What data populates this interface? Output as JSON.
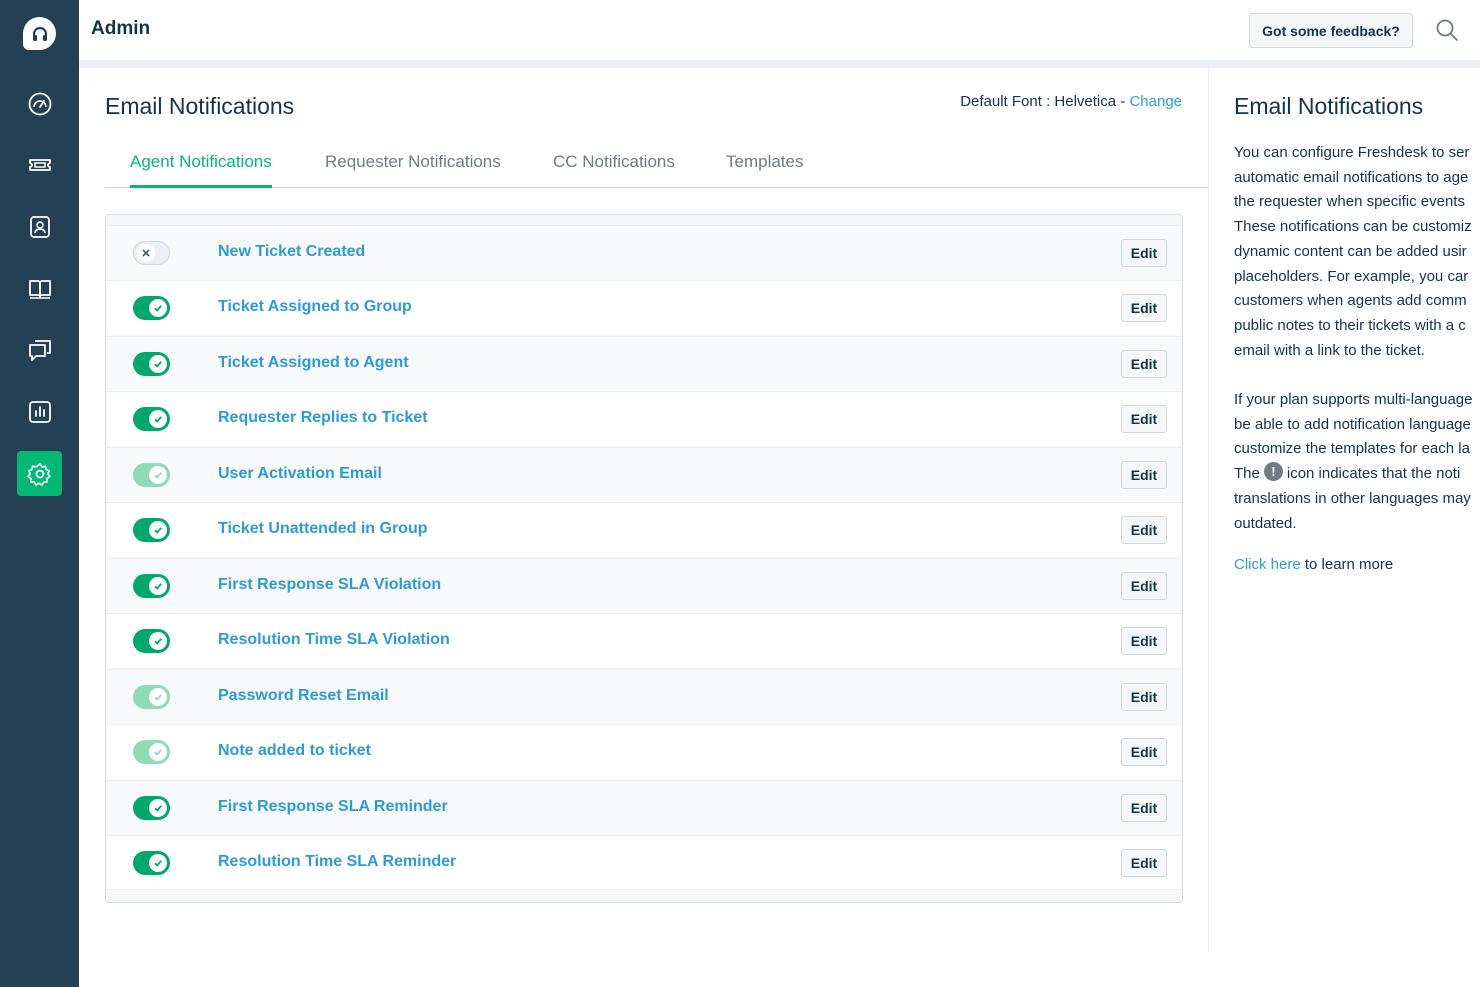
{
  "header": {
    "title": "Admin",
    "feedback_label": "Got some feedback?"
  },
  "sidebar": {
    "items": [
      {
        "icon": "dashboard-icon"
      },
      {
        "icon": "tickets-icon"
      },
      {
        "icon": "contacts-icon"
      },
      {
        "icon": "solutions-icon"
      },
      {
        "icon": "forums-icon"
      },
      {
        "icon": "reports-icon"
      },
      {
        "icon": "admin-gear-icon",
        "active": true
      }
    ]
  },
  "main": {
    "title": "Email Notifications",
    "font_label": "Default Font : ",
    "font_value": "Helvetica",
    "font_separator": " - ",
    "font_change": "Change",
    "tabs": [
      {
        "label": "Agent Notifications",
        "active": true
      },
      {
        "label": "Requester Notifications"
      },
      {
        "label": "CC Notifications"
      },
      {
        "label": "Templates"
      }
    ],
    "edit_label": "Edit",
    "notifications": [
      {
        "label": "New Ticket Created",
        "state": "off"
      },
      {
        "label": "Ticket Assigned to Group",
        "state": "on"
      },
      {
        "label": "Ticket Assigned to Agent",
        "state": "on"
      },
      {
        "label": "Requester Replies to Ticket",
        "state": "on"
      },
      {
        "label": "User Activation Email",
        "state": "disabled-on"
      },
      {
        "label": "Ticket Unattended in Group",
        "state": "on"
      },
      {
        "label": "First Response SLA Violation",
        "state": "on"
      },
      {
        "label": "Resolution Time SLA Violation",
        "state": "on"
      },
      {
        "label": "Password Reset Email",
        "state": "disabled-on"
      },
      {
        "label": "Note added to ticket",
        "state": "disabled-on"
      },
      {
        "label": "First Response SLA Reminder",
        "state": "on"
      },
      {
        "label": "Resolution Time SLA Reminder",
        "state": "on"
      }
    ]
  },
  "panel": {
    "title": "Email Notifications",
    "para1": [
      "You can configure Freshdesk to ser",
      "automatic email notifications to age",
      "the requester when specific events",
      "These notifications can be customiz",
      "dynamic content can be added usir",
      "placeholders. For example, you car",
      "customers when agents add comm",
      "public notes to their tickets with a c",
      "email with a link to the ticket."
    ],
    "para2": [
      "If your plan supports multi-language",
      "be able to add notification language",
      "customize the templates for each la"
    ],
    "para2_icon_before": "The",
    "para2_icon_after": "icon indicates that the noti",
    "para2_rest": [
      "translations in other languages may",
      "outdated."
    ],
    "info_icon_glyph": "!",
    "learn_link": "Click here",
    "learn_rest": " to learn more"
  }
}
